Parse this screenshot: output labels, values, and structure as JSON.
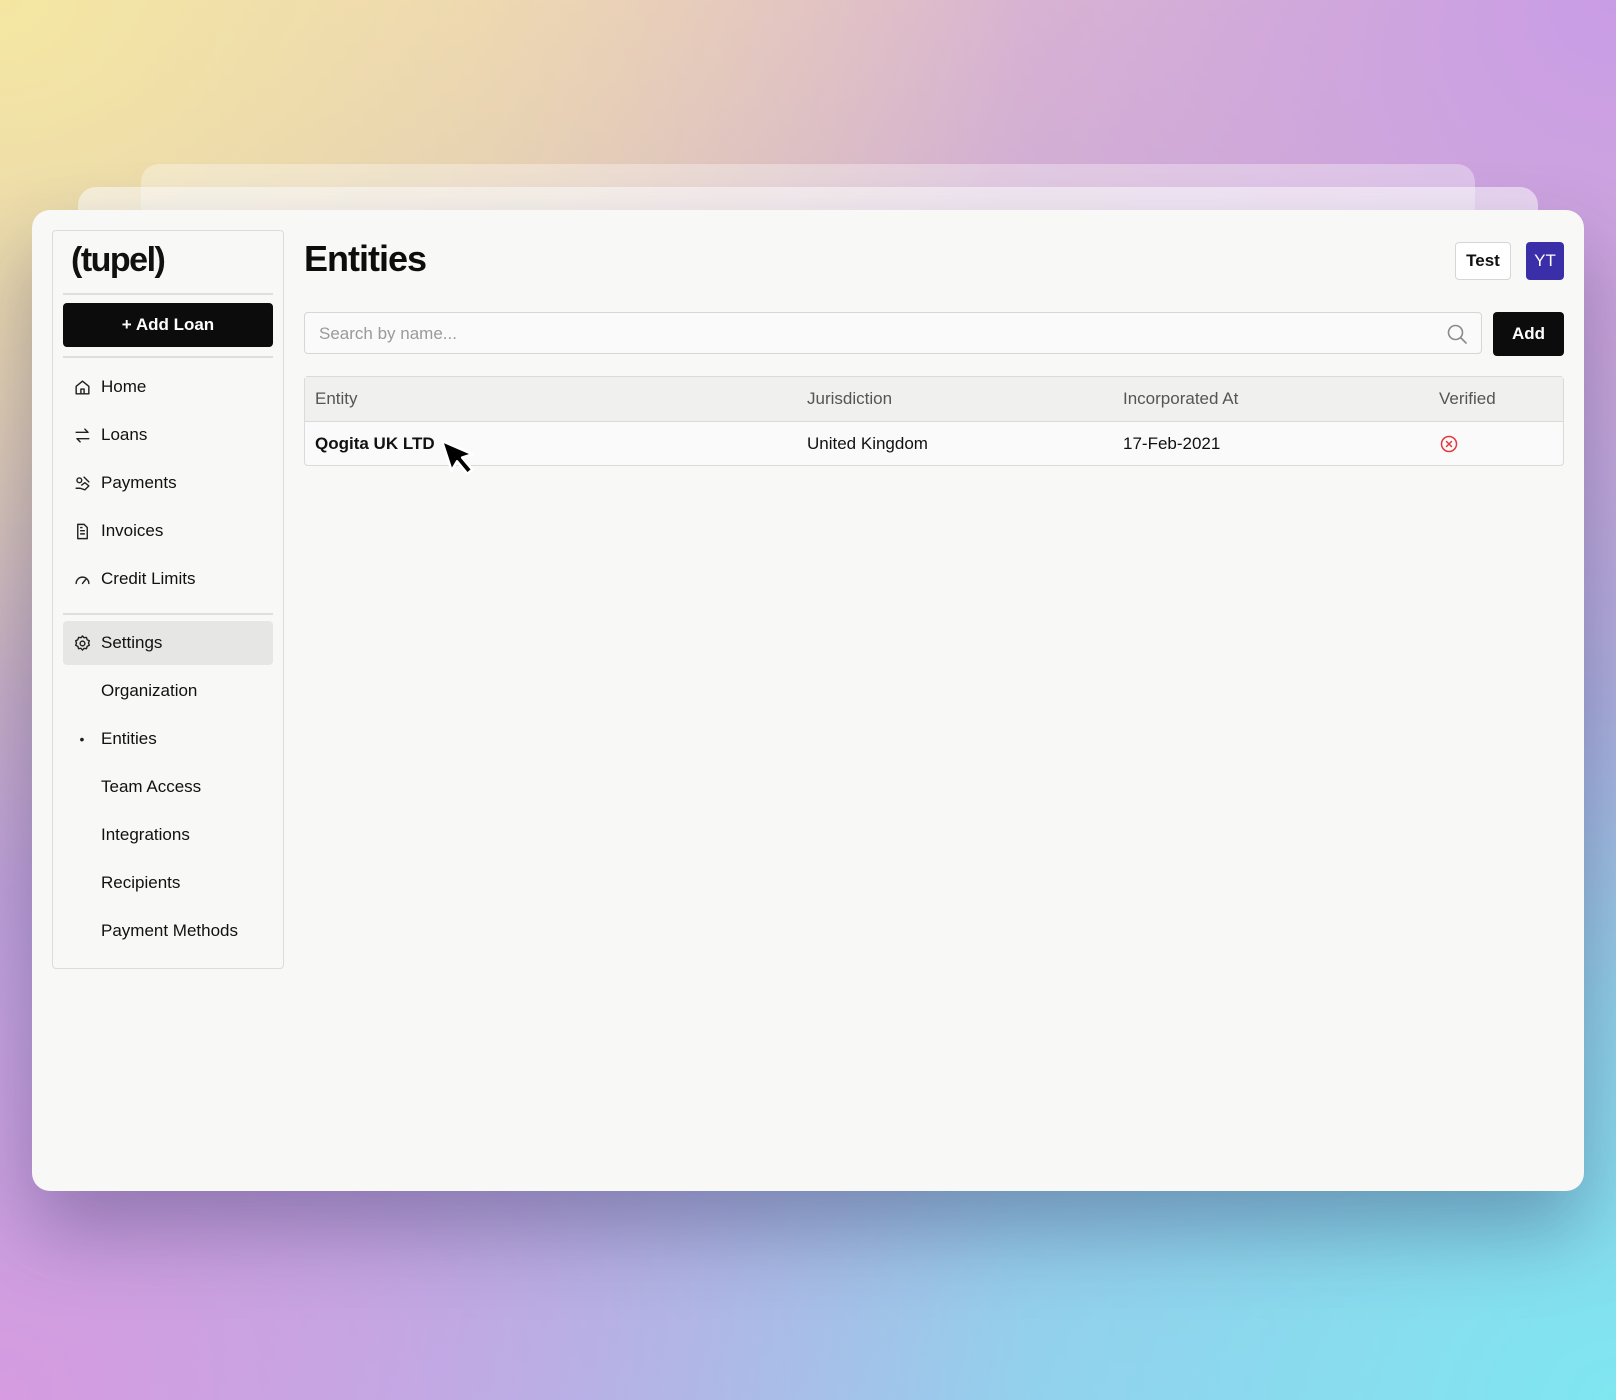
{
  "app": {
    "logo": "(tupel)"
  },
  "sidebar": {
    "add_loan_label": "+ Add Loan",
    "items": [
      {
        "label": "Home",
        "icon": "home-icon"
      },
      {
        "label": "Loans",
        "icon": "arrows-exchange-icon"
      },
      {
        "label": "Payments",
        "icon": "payments-icon"
      },
      {
        "label": "Invoices",
        "icon": "document-icon"
      },
      {
        "label": "Credit Limits",
        "icon": "gauge-icon"
      }
    ],
    "settings": {
      "label": "Settings",
      "icon": "gear-icon"
    },
    "settings_items": [
      {
        "label": "Organization"
      },
      {
        "label": "Entities",
        "bullet": "•"
      },
      {
        "label": "Team Access"
      },
      {
        "label": "Integrations"
      },
      {
        "label": "Recipients"
      },
      {
        "label": "Payment Methods"
      }
    ]
  },
  "header": {
    "title": "Entities",
    "test_label": "Test",
    "avatar_initials": "YT"
  },
  "search": {
    "placeholder": "Search by name...",
    "value": ""
  },
  "toolbar": {
    "add_label": "Add"
  },
  "table": {
    "columns": [
      "Entity",
      "Jurisdiction",
      "Incorporated At",
      "Verified"
    ],
    "rows": [
      {
        "entity": "Qogita UK LTD",
        "jurisdiction": "United Kingdom",
        "incorporated_at": "17-Feb-2021",
        "verified": false
      }
    ]
  },
  "colors": {
    "accent": "#0c0c0c",
    "avatar": "#3a2fa8",
    "unverified": "#e0393e"
  }
}
